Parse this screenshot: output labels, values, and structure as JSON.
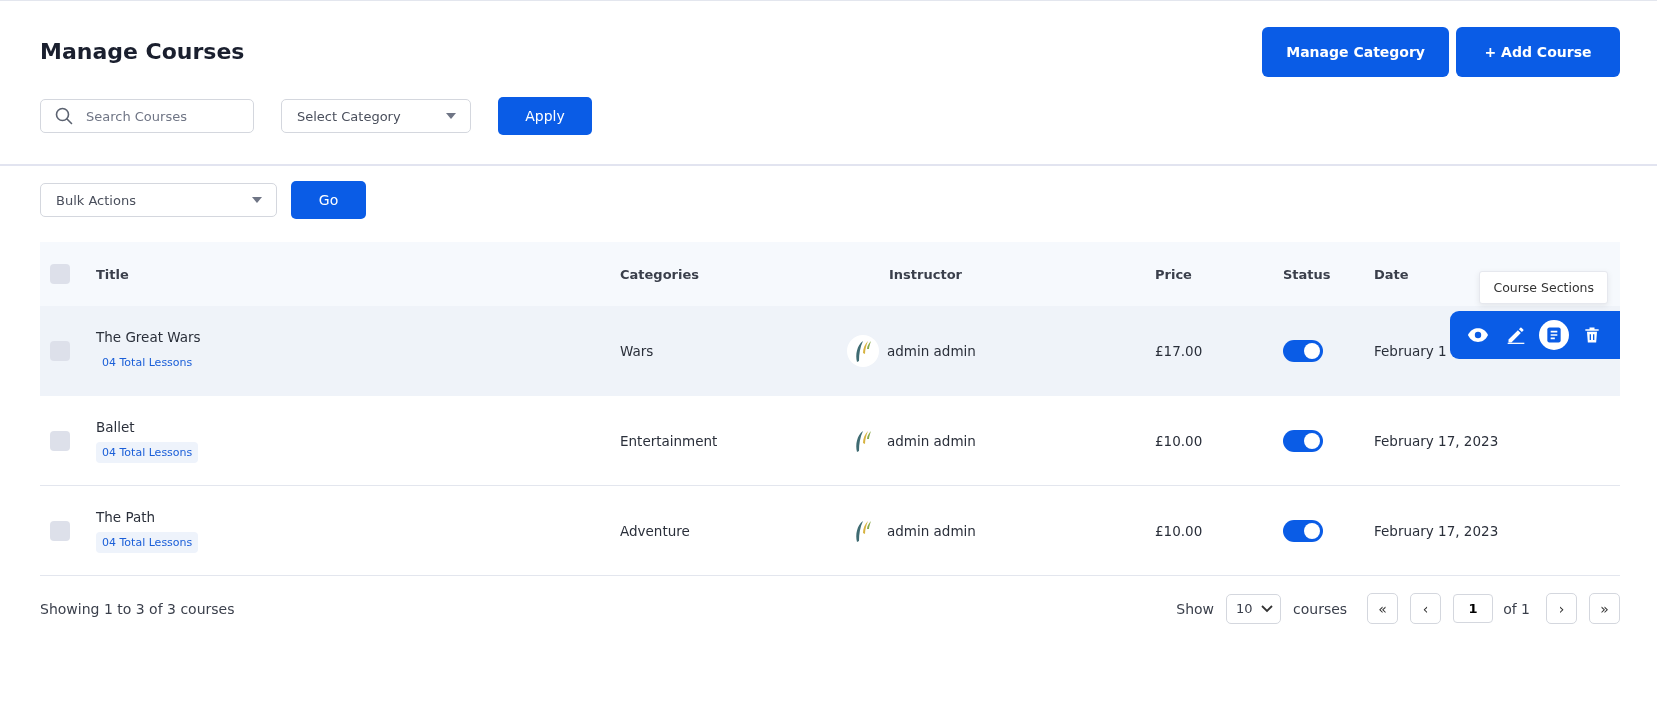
{
  "page_title": "Manage Courses",
  "header_buttons": [
    {
      "kind": "plain",
      "label": "Manage Category"
    },
    {
      "kind": "add",
      "label": "+ Add Course"
    }
  ],
  "filters": {
    "search": {
      "placeholder": "Search Courses"
    },
    "category": {
      "value": "Select Category"
    },
    "apply": "Apply"
  },
  "bulk": {
    "value": "Bulk Actions",
    "go": "Go"
  },
  "table": {
    "select_all_checked": false,
    "columns": [
      "Title",
      "Categories",
      "Instructor",
      "Price",
      "Status",
      "Date"
    ],
    "rows": [
      {
        "checked": false,
        "hovered": true,
        "title": "The Great Wars",
        "lessons": "04 Total Lessons",
        "category": "Wars",
        "instructor": "admin admin",
        "price": "£17.00",
        "on": true,
        "date": "February 1"
      },
      {
        "checked": false,
        "hovered": false,
        "title": "Ballet",
        "lessons": "04 Total Lessons",
        "category": "Entertainment",
        "instructor": "admin admin",
        "price": "£10.00",
        "on": true,
        "date": "February 17, 2023"
      },
      {
        "checked": false,
        "hovered": false,
        "title": "The Path",
        "lessons": "04 Total Lessons",
        "category": "Adventure",
        "instructor": "admin admin",
        "price": "£10.00",
        "on": true,
        "date": "February 17, 2023"
      }
    ]
  },
  "row_actions": {
    "tooltip": "Course Sections",
    "actions": [
      {
        "kind": "view",
        "selected": false
      },
      {
        "kind": "edit",
        "selected": false
      },
      {
        "kind": "sections",
        "selected": true
      },
      {
        "kind": "delete",
        "selected": false
      }
    ]
  },
  "footer": {
    "summary": "Showing 1 to 3 of 3 courses",
    "show_label": "Show",
    "per_page": "10",
    "per_page_unit": "courses",
    "first": "«",
    "prev": "‹",
    "page": "1",
    "of": "of 1",
    "next": "›",
    "last": "»"
  }
}
